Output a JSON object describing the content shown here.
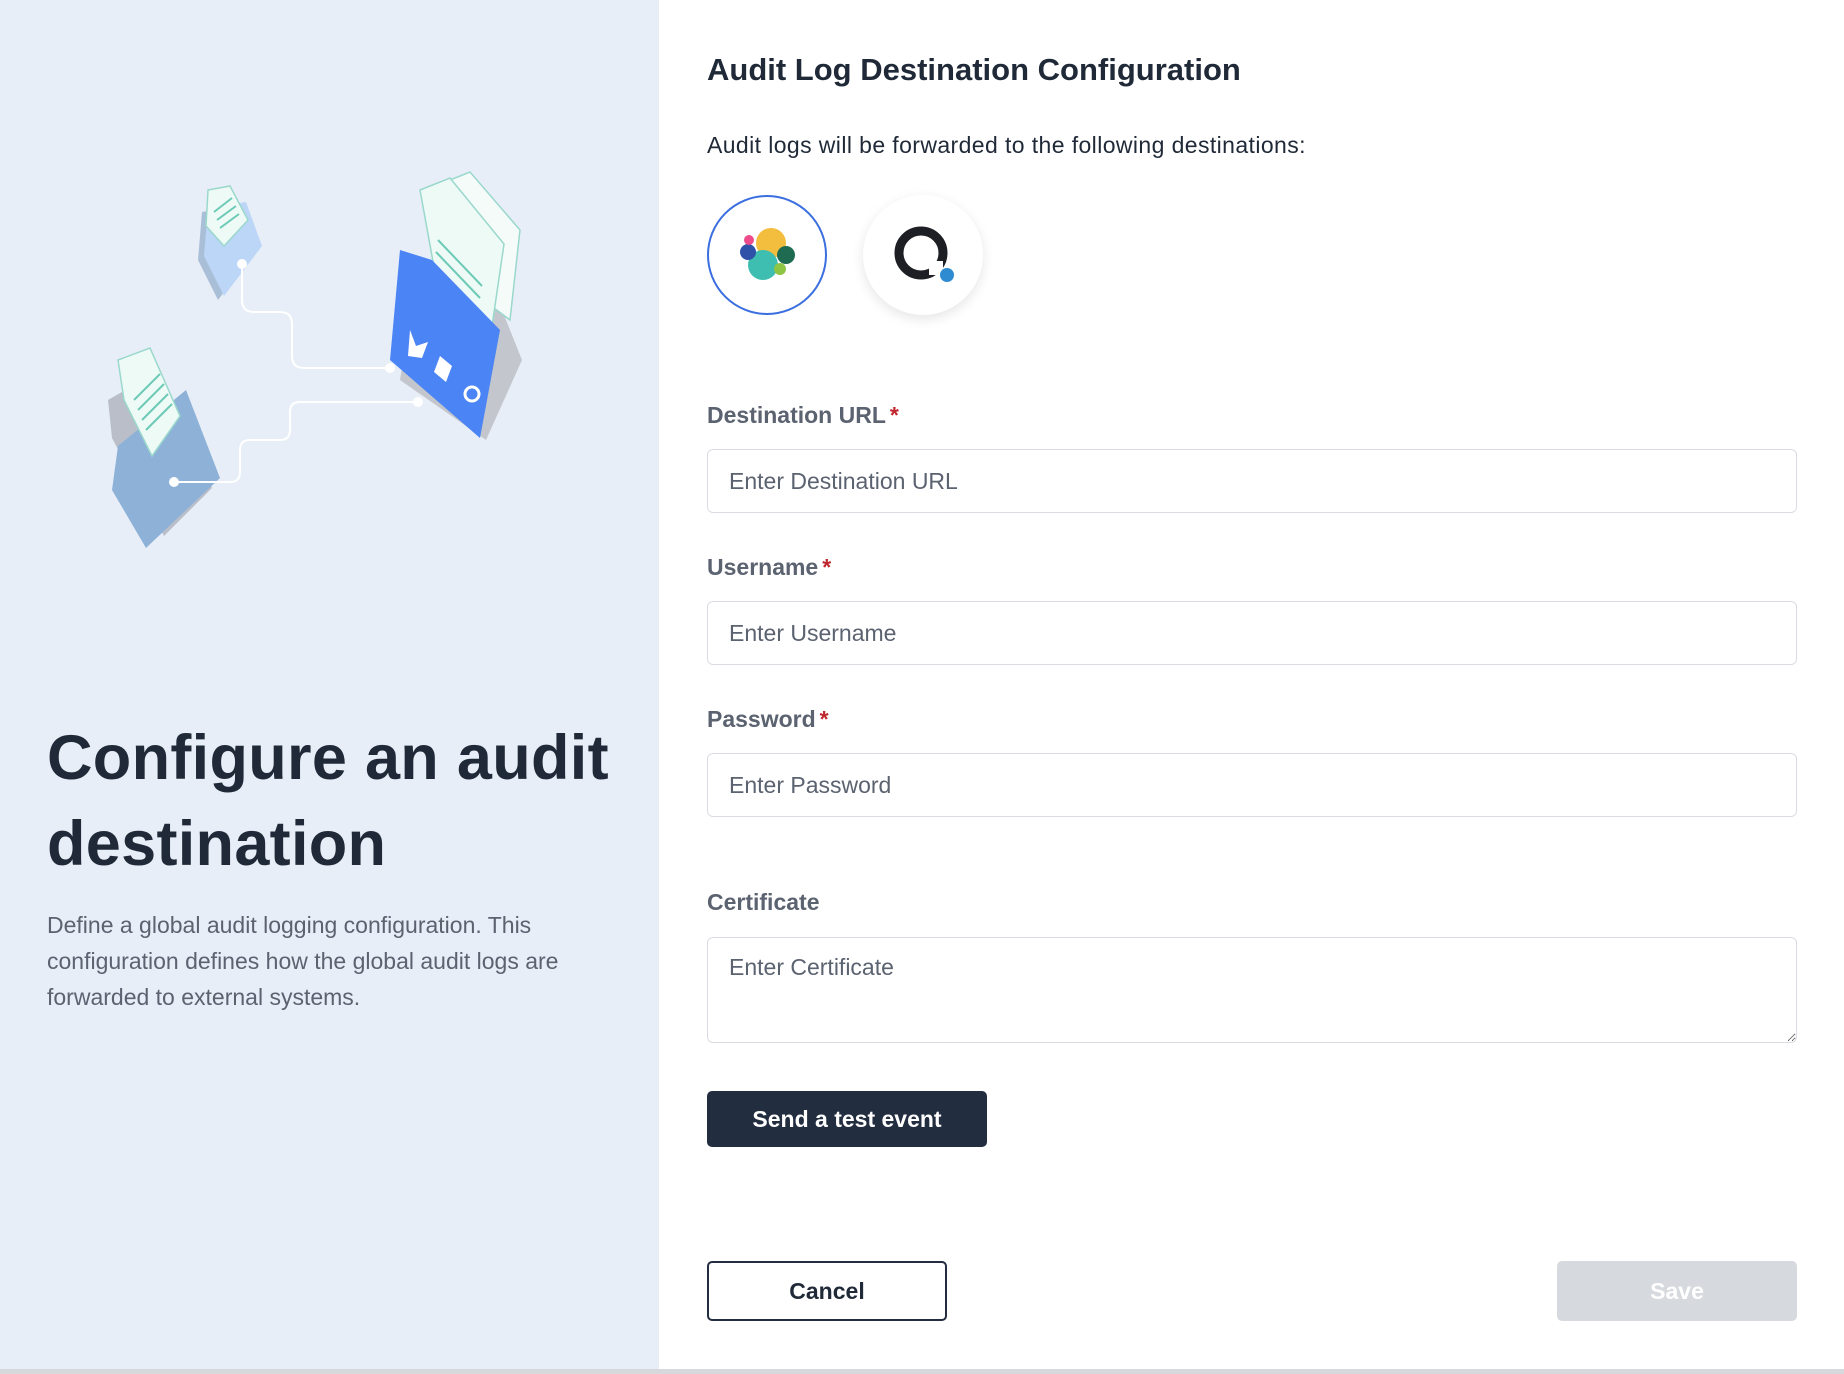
{
  "left": {
    "title": "Configure an audit destination",
    "description": "Define a global audit logging configuration. This configuration defines how the global audit logs are forwarded to external systems."
  },
  "form": {
    "title": "Audit Log Destination Configuration",
    "subtitle": "Audit logs will be forwarded to the following destinations:",
    "destinations": [
      {
        "icon": "elastic-logo-icon",
        "selected": true
      },
      {
        "icon": "q-logo-icon",
        "selected": false
      }
    ],
    "fields": {
      "url": {
        "label": "Destination URL",
        "required_mark": "*",
        "placeholder": "Enter Destination URL",
        "value": ""
      },
      "username": {
        "label": "Username",
        "required_mark": "*",
        "placeholder": "Enter Username",
        "value": ""
      },
      "password": {
        "label": "Password",
        "required_mark": "*",
        "placeholder": "Enter Password",
        "value": ""
      },
      "certificate": {
        "label": "Certificate",
        "placeholder": "Enter Certificate",
        "value": ""
      }
    },
    "test_button": "Send a test event",
    "cancel_button": "Cancel",
    "save_button": "Save"
  },
  "colors": {
    "left_bg": "#e8eef8",
    "primary": "#232d40",
    "accent_blue": "#3b6fdf",
    "required": "#c0262d",
    "save_disabled": "#d6d9de"
  }
}
